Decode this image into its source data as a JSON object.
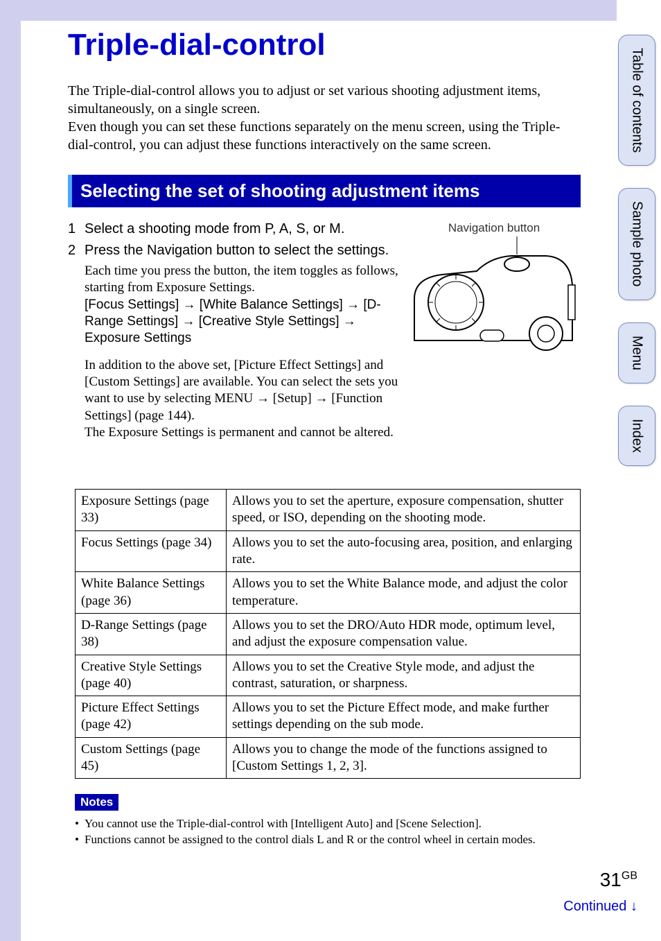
{
  "title": "Triple-dial-control",
  "intro": "The Triple-dial-control allows you to adjust or set various shooting adjustment items, simultaneously, on a single screen.\nEven though you can set these functions separately on the menu screen, using the Triple-dial-control, you can adjust these functions interactively on the same screen.",
  "section_header": "Selecting the set of shooting adjustment items",
  "illustration_label": "Navigation button",
  "steps": [
    {
      "num": "1",
      "text": "Select a shooting mode from P, A, S, or M."
    },
    {
      "num": "2",
      "text": "Press the Navigation button to select the settings.",
      "body_p1_pre": "Each time you press the button, the item toggles as follows, starting from Exposure Settings.",
      "body_p1_seq": "[Focus Settings] → [White Balance Settings] → [D-Range Settings] → [Creative Style Settings] → Exposure Settings",
      "body_p2": "In addition to the above set, [Picture Effect Settings] and [Custom Settings] are available. You can select the sets you want to use by selecting MENU → [Setup] → [Function Settings] (page 144).\nThe Exposure Settings is permanent and cannot be altered."
    }
  ],
  "table": [
    {
      "name": "Exposure Settings (page 33)",
      "desc": "Allows you to set the aperture, exposure compensation, shutter speed, or ISO, depending on the shooting mode."
    },
    {
      "name": "Focus Settings (page 34)",
      "desc": "Allows you to set the auto-focusing area, position, and enlarging rate."
    },
    {
      "name": "White Balance Settings (page 36)",
      "desc": "Allows you to set the White Balance mode, and adjust the color temperature."
    },
    {
      "name": "D-Range Settings (page 38)",
      "desc": "Allows you to set the DRO/Auto HDR mode, optimum level, and adjust the exposure compensation value."
    },
    {
      "name": "Creative Style Settings (page 40)",
      "desc": "Allows you to set the Creative Style mode, and adjust the contrast, saturation, or sharpness."
    },
    {
      "name": "Picture Effect Settings (page 42)",
      "desc": "Allows you to set the Picture Effect mode, and make further settings depending on the sub mode."
    },
    {
      "name": "Custom Settings (page 45)",
      "desc": "Allows you to change the mode of the functions assigned to [Custom Settings 1, 2, 3]."
    }
  ],
  "notes": {
    "label": "Notes",
    "items": [
      "You cannot use the Triple-dial-control with [Intelligent Auto] and [Scene Selection].",
      "Functions cannot be assigned to the control dials L and R or the control wheel in certain modes."
    ]
  },
  "side_tabs": [
    "Table of contents",
    "Sample photo",
    "Menu",
    "Index"
  ],
  "page_number": "31",
  "page_suffix": "GB",
  "continued": "Continued ↓"
}
